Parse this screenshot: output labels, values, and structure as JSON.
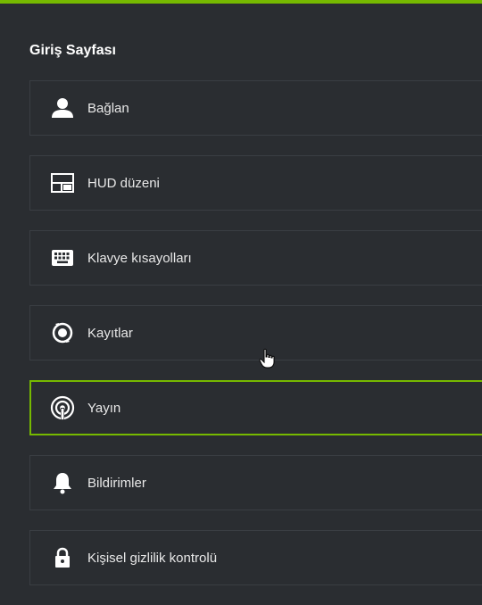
{
  "page": {
    "title": "Giriş Sayfası",
    "accent_color": "#76b900"
  },
  "menu": {
    "items": [
      {
        "label": "Bağlan",
        "icon": "user-icon",
        "selected": false
      },
      {
        "label": "HUD düzeni",
        "icon": "layout-icon",
        "selected": false
      },
      {
        "label": "Klavye kısayolları",
        "icon": "keyboard-icon",
        "selected": false
      },
      {
        "label": "Kayıtlar",
        "icon": "record-icon",
        "selected": false
      },
      {
        "label": "Yayın",
        "icon": "broadcast-icon",
        "selected": true
      },
      {
        "label": "Bildirimler",
        "icon": "bell-icon",
        "selected": false
      },
      {
        "label": "Kişisel gizlilik kontrolü",
        "icon": "lock-icon",
        "selected": false
      }
    ]
  }
}
